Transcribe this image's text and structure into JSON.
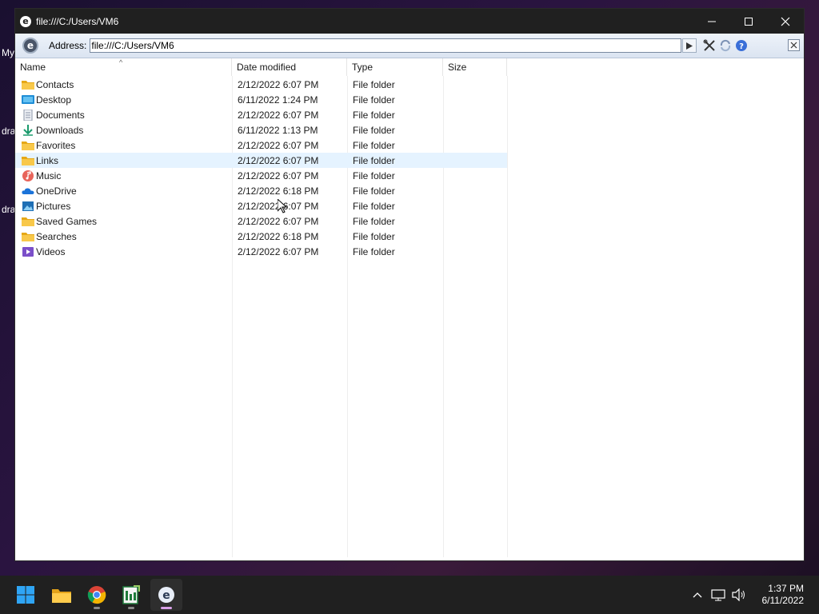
{
  "desktop": {
    "labels": [
      "My",
      "dra",
      "dra"
    ]
  },
  "window": {
    "title": "file:///C:/Users/VM6"
  },
  "toolbar": {
    "address_label": "Address:",
    "address_value": "file:///C:/Users/VM6"
  },
  "list": {
    "columns": {
      "name": "Name",
      "date": "Date modified",
      "type": "Type",
      "size": "Size"
    },
    "rows": [
      {
        "name": "Contacts",
        "date": "2/12/2022 6:07 PM",
        "type": "File folder",
        "icon": "folder-icon"
      },
      {
        "name": "Desktop",
        "date": "6/11/2022 1:24 PM",
        "type": "File folder",
        "icon": "desktop-folder-icon"
      },
      {
        "name": "Documents",
        "date": "2/12/2022 6:07 PM",
        "type": "File folder",
        "icon": "documents-folder-icon"
      },
      {
        "name": "Downloads",
        "date": "6/11/2022 1:13 PM",
        "type": "File folder",
        "icon": "downloads-folder-icon"
      },
      {
        "name": "Favorites",
        "date": "2/12/2022 6:07 PM",
        "type": "File folder",
        "icon": "folder-icon"
      },
      {
        "name": "Links",
        "date": "2/12/2022 6:07 PM",
        "type": "File folder",
        "icon": "folder-icon"
      },
      {
        "name": "Music",
        "date": "2/12/2022 6:07 PM",
        "type": "File folder",
        "icon": "music-folder-icon"
      },
      {
        "name": "OneDrive",
        "date": "2/12/2022 6:18 PM",
        "type": "File folder",
        "icon": "onedrive-icon"
      },
      {
        "name": "Pictures",
        "date": "2/12/2022 6:07 PM",
        "type": "File folder",
        "icon": "pictures-folder-icon"
      },
      {
        "name": "Saved Games",
        "date": "2/12/2022 6:07 PM",
        "type": "File folder",
        "icon": "folder-icon"
      },
      {
        "name": "Searches",
        "date": "2/12/2022 6:18 PM",
        "type": "File folder",
        "icon": "folder-icon"
      },
      {
        "name": "Videos",
        "date": "2/12/2022 6:07 PM",
        "type": "File folder",
        "icon": "videos-folder-icon"
      }
    ]
  },
  "taskbar": {
    "apps": [
      "start-icon",
      "file-explorer-icon",
      "chrome-icon",
      "spreadsheet-app-icon",
      "browser-app-icon"
    ]
  },
  "clock": {
    "time": "1:37 PM",
    "date": "6/11/2022"
  },
  "colors": {
    "hover_row": "#e5f3ff",
    "folder": "#f8c84a",
    "taskbar": "#202020"
  }
}
